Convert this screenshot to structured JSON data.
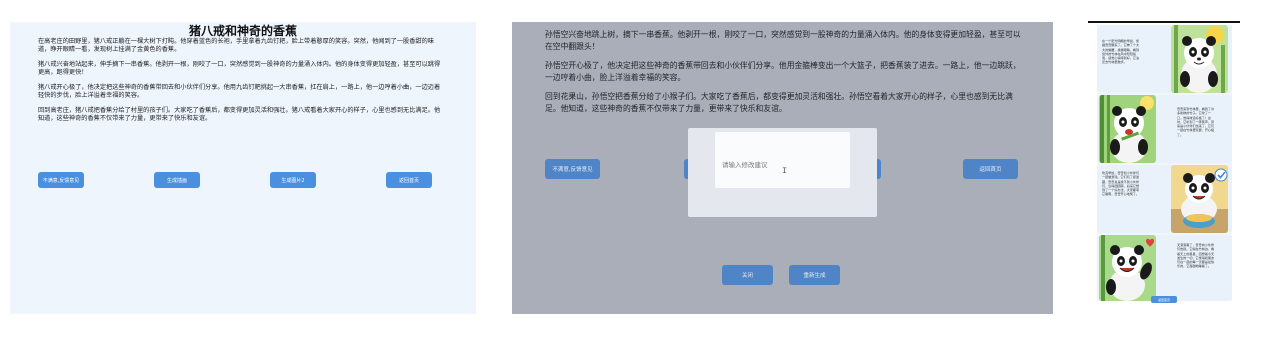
{
  "panel1": {
    "title": "猪八戒和神奇的香蕉",
    "paragraphs": [
      "在高老庄的田野里，猪八戒正躺在一棵大树下打盹。他穿着蓝色的长袍，手里拿着九齿钉耙，脸上带着憨厚的笑容。突然，他闻到了一股香甜的味道，睁开眼睛一看，发现树上挂满了金黄色的香蕉。",
      "猪八戒兴奋地站起来，伸手摘下一串香蕉。他剥开一根，刚咬了一口，突然感觉到一股神奇的力量涌入体内。他的身体变得更加轻盈，甚至可以跳得更高，跑得更快！",
      "猪八戒开心极了，他决定把这些神奇的香蕉带回去和小伙伴们分享。他用九齿钉耙挑起一大串香蕉，扛在肩上，一路上，他一边哼着小曲，一边迈着轻快的步伐，脸上洋溢着幸福的笑容。",
      "回到高老庄，猪八戒把香蕉分给了村里的孩子们。大家吃了香蕉后，都变得更加灵活和强壮。猪八戒看着大家开心的样子，心里也感到无比满足。他知道，这些神奇的香蕉不仅带来了力量，更带来了快乐和友谊。"
    ],
    "buttons": [
      "不满意,反馈意见",
      "生成插画",
      "生成图片2",
      "返回首页"
    ]
  },
  "panel2": {
    "paragraphs": [
      "孙悟空兴奋地跳上树，摘下一串香蕉。他剥开一根，刚咬了一口，突然感觉到一股神奇的力量涌入体内。他的身体变得更加轻盈，甚至可以在空中翻跟头！",
      "孙悟空开心极了，他决定把这些神奇的香蕉带回去和小伙伴们分享。他用金箍棒变出一个大篮子，把香蕉装了进去。一路上，他一边跳跃，一边哼着小曲，脸上洋溢着幸福的笑容。",
      "回到花果山，孙悟空把香蕉分给了小猴子们。大家吃了香蕉后，都变得更加灵活和强壮。孙悟空看着大家开心的样子，心里也感到无比满足。他知道，这些神奇的香蕉不仅带来了力量，更带来了快乐和友谊。"
    ],
    "buttons": [
      "不满意,反馈意见",
      "返回首页"
    ],
    "dialog": {
      "placeholder": "请输入修改建议",
      "close_label": "关闭",
      "regen_label": "重新生成"
    }
  },
  "panel3": {
    "cards": [
      {
        "text": "在一个阳光明媚的早晨，熊猫奇奇醒来了。它伸了个大大的懒腰，揉揉眼睛，看到窗外的竹林在风中轻轻摇曳，感觉心情特别好，它决定去竹林里散步。"
      },
      {
        "text": "奇奇来到竹林里，看到了许多新鲜的竹子。它咬了一口，觉得味道好极了！这时，它听到了一阵笑声，原来是小伙伴们也来了，它们一起在竹林里玩耍，开心极了。"
      },
      {
        "text": "吃完早饭，奇奇和小伙伴们一起做游戏。它们玩了捉迷藏，奇奇总是找不到小伙伴们，急得团团转。后来它想到了一个好办法，大家都夸它聪明，奇奇开心地笑了。"
      },
      {
        "text": "天渐渐黑了，奇奇向小伙伴们告别。它躺在竹林边，看着天上的星星，回想着今天发生的一切，它觉得和朋友们在一起的每一天都是最快乐的，它甜甜地睡着了。"
      }
    ],
    "button": "返回首页"
  }
}
